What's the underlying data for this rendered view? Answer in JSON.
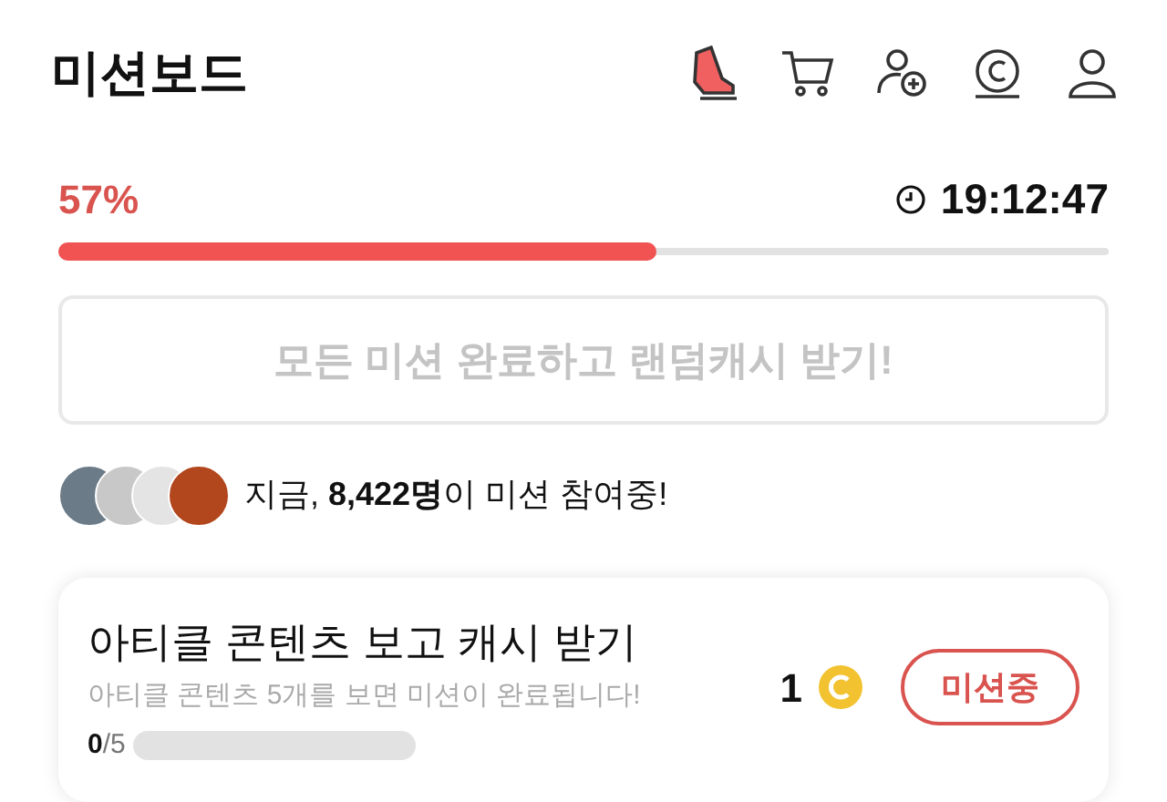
{
  "header": {
    "title": "미션보드"
  },
  "progress": {
    "percent": "57%",
    "level": 0.57,
    "time": "19:12:47"
  },
  "reward_button": {
    "label": "모든 미션 완료하고 랜덤캐시 받기!",
    "disabled": true
  },
  "participants": {
    "prefix": "지금, ",
    "count": "8,422명",
    "suffix": "이 미션 참여중!"
  },
  "missions": [
    {
      "title": "아티클 콘텐츠 보고 캐시 받기",
      "description": "아티클 콘텐츠 5개를 보면 미션이 완료됩니다!",
      "done": "0",
      "total": "/5",
      "reward": "1",
      "status": "미션중"
    }
  ]
}
